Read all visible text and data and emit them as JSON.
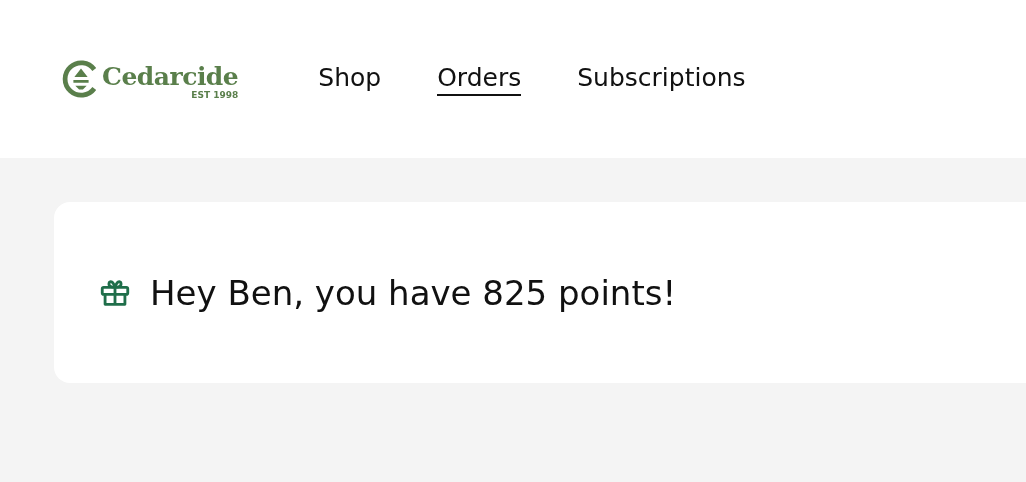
{
  "logo": {
    "name": "Cedarcide",
    "tagline": "EST 1998"
  },
  "nav": [
    {
      "label": "Shop",
      "selected": false
    },
    {
      "label": "Orders",
      "selected": true
    },
    {
      "label": "Subscriptions",
      "selected": false
    }
  ],
  "rewards": {
    "message": "Hey Ben, you have 825 points!"
  }
}
